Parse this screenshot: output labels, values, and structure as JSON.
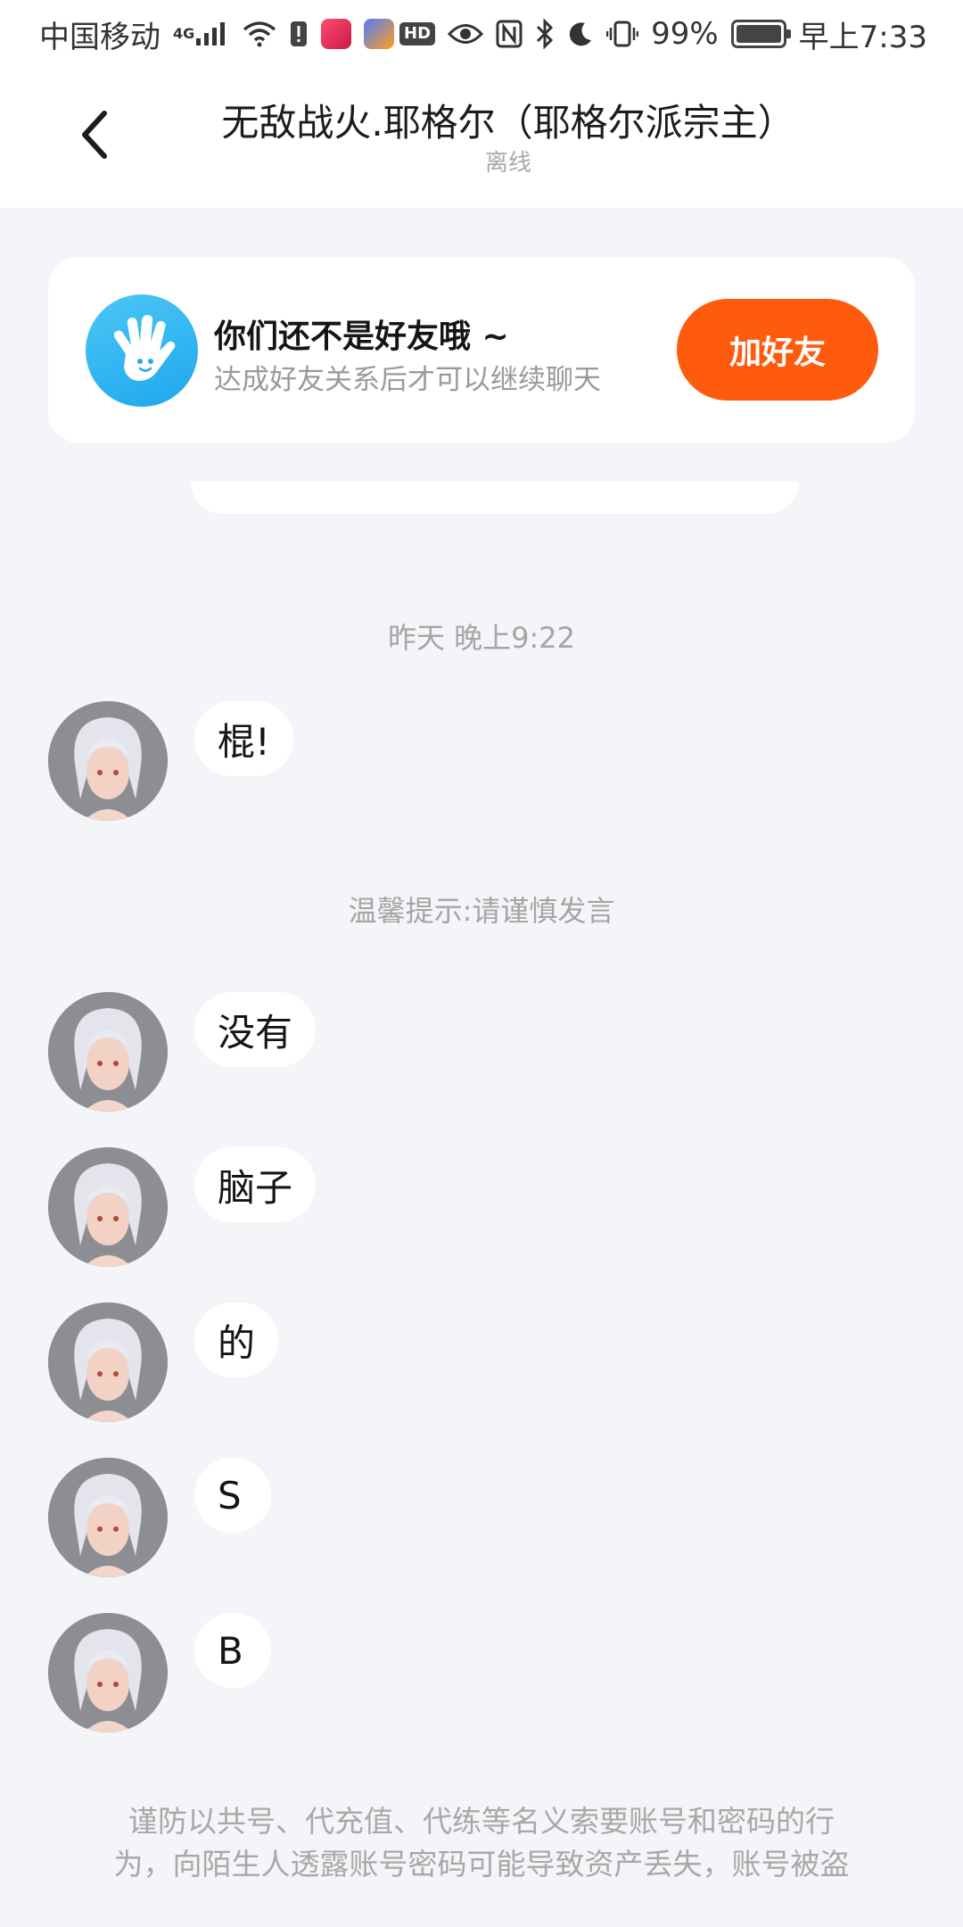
{
  "status_bar": {
    "carrier": "中国移动",
    "network": "4G",
    "battery_percent": "99%",
    "time": "早上7:33"
  },
  "header": {
    "title": "无敌战火.耶格尔（耶格尔派宗主）",
    "status": "离线"
  },
  "friend_card": {
    "title": "你们还不是好友哦 ~",
    "subtitle": "达成好友关系后才可以继续聊天",
    "button_label": "加好友"
  },
  "chat": {
    "timestamp": "昨天 晚上9:22",
    "tip": "温馨提示:请谨慎发言",
    "messages": [
      {
        "text": "棍!"
      },
      {
        "text": "没有"
      },
      {
        "text": "脑子"
      },
      {
        "text": "的"
      },
      {
        "text": "S"
      },
      {
        "text": "B"
      }
    ]
  },
  "footer_warning": {
    "line1": "谨防以共号、代充值、代练等名义索要账号和密码的行",
    "line2": "为，向陌生人透露账号密码可能导致资产丢失，账号被盗"
  },
  "colors": {
    "accent": "#ff5b0e",
    "hand_icon_bg": "#2bb3f0",
    "page_bg": "#f3f5f8"
  }
}
